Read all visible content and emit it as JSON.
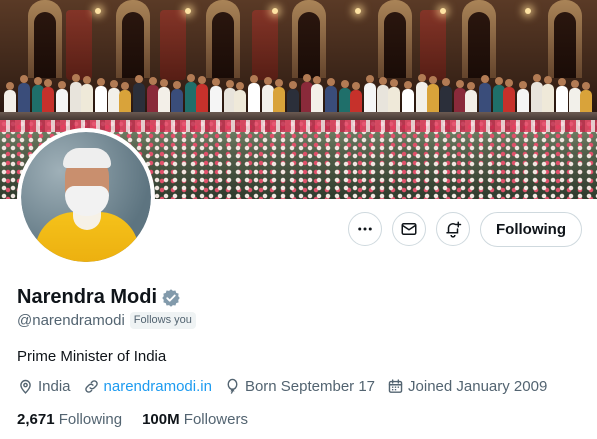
{
  "profile": {
    "name": "Narendra Modi",
    "handle": "@narendramodi",
    "follows_you": "Follows you",
    "bio": "Prime Minister of India",
    "location": "India",
    "website": "narendramodi.in",
    "born": "Born September 17",
    "joined": "Joined January 2009",
    "verified": true
  },
  "stats": {
    "following_count": "2,671",
    "following_label": "Following",
    "followers_count": "100M",
    "followers_label": "Followers"
  },
  "actions": {
    "following_button": "Following",
    "more_icon": "more-icon",
    "message_icon": "mail-icon",
    "notify_icon": "bell-plus-icon"
  },
  "colors": {
    "accent": "#1d9bf0",
    "text_primary": "#0f1419",
    "text_secondary": "#536471",
    "border": "#cfd9de",
    "badge_bg": "#eff3f4"
  }
}
